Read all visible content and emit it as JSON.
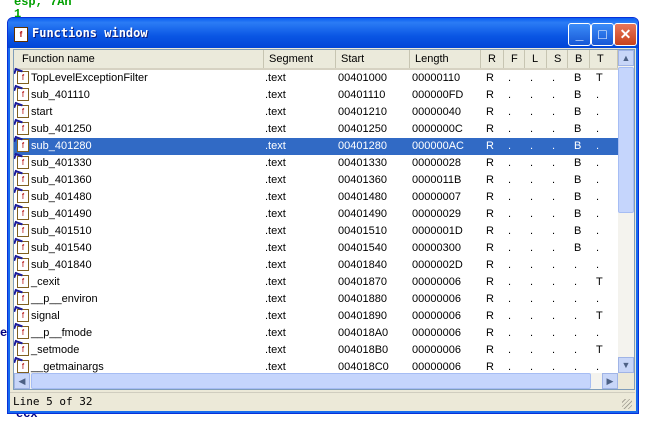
{
  "background": {
    "top_code": "esp, 7Ah",
    "top_code_line2": "1",
    "bottom_code": "ecx",
    "left_char": "e"
  },
  "window": {
    "title": "Functions window",
    "min_glyph": "_",
    "max_glyph": "□",
    "close_glyph": "✕"
  },
  "columns": [
    {
      "key": "name",
      "label": "Function name"
    },
    {
      "key": "segment",
      "label": "Segment"
    },
    {
      "key": "start",
      "label": "Start"
    },
    {
      "key": "length",
      "label": "Length"
    },
    {
      "key": "r",
      "label": "R"
    },
    {
      "key": "f",
      "label": "F"
    },
    {
      "key": "l",
      "label": "L"
    },
    {
      "key": "s",
      "label": "S"
    },
    {
      "key": "b",
      "label": "B"
    },
    {
      "key": "t",
      "label": "T"
    }
  ],
  "rows": [
    {
      "name": "TopLevelExceptionFilter",
      "segment": ".text",
      "start": "00401000",
      "length": "00000110",
      "r": "R",
      "f": ".",
      "l": ".",
      "s": ".",
      "b": "B",
      "t": "T"
    },
    {
      "name": "sub_401110",
      "segment": ".text",
      "start": "00401110",
      "length": "000000FD",
      "r": "R",
      "f": ".",
      "l": ".",
      "s": ".",
      "b": "B",
      "t": "."
    },
    {
      "name": "start",
      "segment": ".text",
      "start": "00401210",
      "length": "00000040",
      "r": "R",
      "f": ".",
      "l": ".",
      "s": ".",
      "b": "B",
      "t": "."
    },
    {
      "name": "sub_401250",
      "segment": ".text",
      "start": "00401250",
      "length": "0000000C",
      "r": "R",
      "f": ".",
      "l": ".",
      "s": ".",
      "b": "B",
      "t": "."
    },
    {
      "name": "sub_401280",
      "segment": ".text",
      "start": "00401280",
      "length": "000000AC",
      "r": "R",
      "f": ".",
      "l": ".",
      "s": ".",
      "b": "B",
      "t": ".",
      "selected": true
    },
    {
      "name": "sub_401330",
      "segment": ".text",
      "start": "00401330",
      "length": "00000028",
      "r": "R",
      "f": ".",
      "l": ".",
      "s": ".",
      "b": "B",
      "t": "."
    },
    {
      "name": "sub_401360",
      "segment": ".text",
      "start": "00401360",
      "length": "0000011B",
      "r": "R",
      "f": ".",
      "l": ".",
      "s": ".",
      "b": "B",
      "t": "."
    },
    {
      "name": "sub_401480",
      "segment": ".text",
      "start": "00401480",
      "length": "00000007",
      "r": "R",
      "f": ".",
      "l": ".",
      "s": ".",
      "b": "B",
      "t": "."
    },
    {
      "name": "sub_401490",
      "segment": ".text",
      "start": "00401490",
      "length": "00000029",
      "r": "R",
      "f": ".",
      "l": ".",
      "s": ".",
      "b": "B",
      "t": "."
    },
    {
      "name": "sub_401510",
      "segment": ".text",
      "start": "00401510",
      "length": "0000001D",
      "r": "R",
      "f": ".",
      "l": ".",
      "s": ".",
      "b": "B",
      "t": "."
    },
    {
      "name": "sub_401540",
      "segment": ".text",
      "start": "00401540",
      "length": "00000300",
      "r": "R",
      "f": ".",
      "l": ".",
      "s": ".",
      "b": "B",
      "t": "."
    },
    {
      "name": "sub_401840",
      "segment": ".text",
      "start": "00401840",
      "length": "0000002D",
      "r": "R",
      "f": ".",
      "l": ".",
      "s": ".",
      "b": ".",
      "t": "."
    },
    {
      "name": "_cexit",
      "segment": ".text",
      "start": "00401870",
      "length": "00000006",
      "r": "R",
      "f": ".",
      "l": ".",
      "s": ".",
      "b": ".",
      "t": "T"
    },
    {
      "name": "__p__environ",
      "segment": ".text",
      "start": "00401880",
      "length": "00000006",
      "r": "R",
      "f": ".",
      "l": ".",
      "s": ".",
      "b": ".",
      "t": "."
    },
    {
      "name": "signal",
      "segment": ".text",
      "start": "00401890",
      "length": "00000006",
      "r": "R",
      "f": ".",
      "l": ".",
      "s": ".",
      "b": ".",
      "t": "T"
    },
    {
      "name": "__p__fmode",
      "segment": ".text",
      "start": "004018A0",
      "length": "00000006",
      "r": "R",
      "f": ".",
      "l": ".",
      "s": ".",
      "b": ".",
      "t": "."
    },
    {
      "name": "_setmode",
      "segment": ".text",
      "start": "004018B0",
      "length": "00000006",
      "r": "R",
      "f": ".",
      "l": ".",
      "s": ".",
      "b": ".",
      "t": "T"
    },
    {
      "name": "__getmainargs",
      "segment": ".text",
      "start": "004018C0",
      "length": "00000006",
      "r": "R",
      "f": ".",
      "l": ".",
      "s": ".",
      "b": ".",
      "t": "."
    }
  ],
  "status": {
    "text": "Line 5 of 32"
  },
  "colors": {
    "selection": "#316ac5",
    "titlebar": "#0a56e4"
  }
}
